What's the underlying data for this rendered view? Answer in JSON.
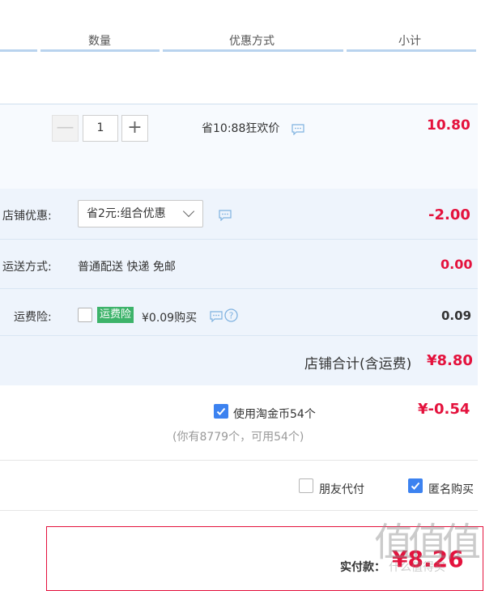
{
  "header": {
    "col_quantity": "数量",
    "col_discount": "优惠方式",
    "col_subtotal": "小计"
  },
  "item": {
    "quantity": "1",
    "promo_text": "省10:88狂欢价",
    "subtotal": "10.80",
    "minus_symbol": "—",
    "plus_symbol": "+"
  },
  "shop": {
    "discount_label": "店铺优惠:",
    "discount_selected": "省2元:组合优惠",
    "discount_amount": "-2.00",
    "shipping_label": "运送方式:",
    "shipping_value": "普通配送 快递 免邮",
    "shipping_amount": "0.00",
    "insurance_label": "运费险:",
    "insurance_tag": "运费险",
    "insurance_price": "¥0.09购买",
    "insurance_amount": "0.09",
    "total_label": "店铺合计(含运费)",
    "total_amount": "¥8.80"
  },
  "coins": {
    "use_label": "使用淘金币54个",
    "amount": "¥-0.54",
    "note": "(你有8779个，可用54个)",
    "checked": true
  },
  "options": {
    "friend_pay_label": "朋友代付",
    "friend_pay_checked": false,
    "anonymous_label": "匿名购买",
    "anonymous_checked": true
  },
  "payment": {
    "label": "实付款：",
    "amount": "¥8.26"
  },
  "watermark": {
    "logo_text": "值",
    "url_text": "什么值得买"
  },
  "colors": {
    "price_red": "#e4123d",
    "checkbox_blue": "#3c82f0",
    "tag_green": "#3db36a",
    "panel_bg": "#eef4fc",
    "header_line": "#b9d3ee"
  }
}
